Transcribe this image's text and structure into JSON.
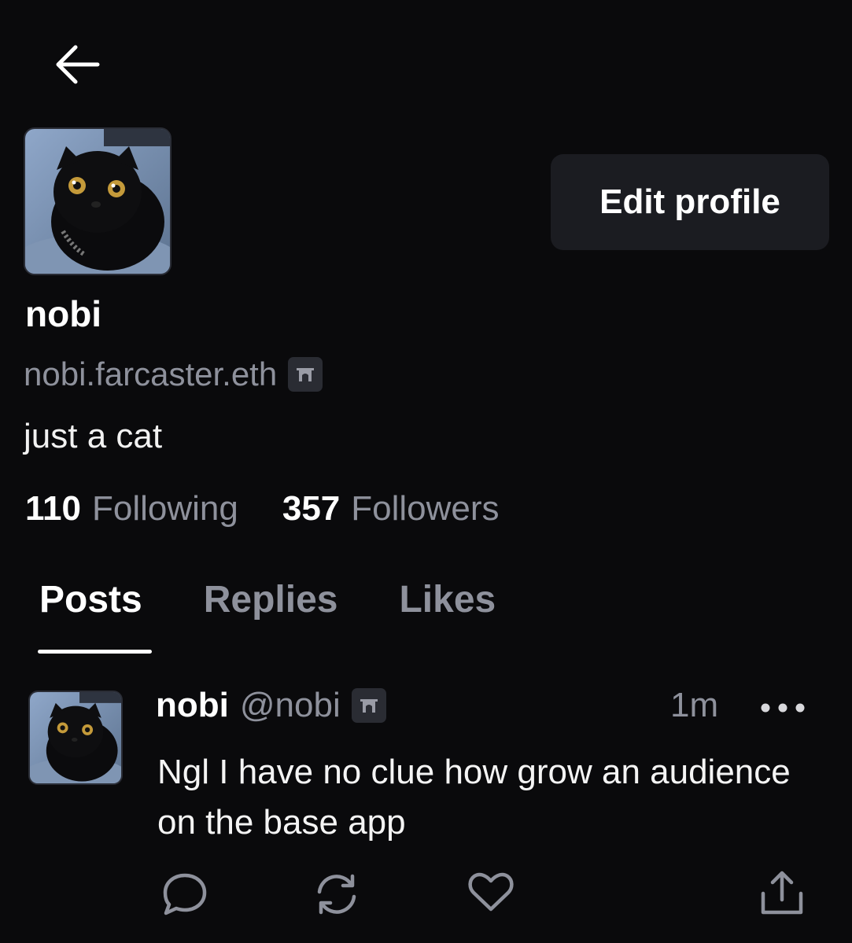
{
  "header": {
    "back_icon": "arrow-left-icon"
  },
  "profile": {
    "avatar_icon": "black-cat-avatar",
    "edit_label": "Edit profile",
    "display_name": "nobi",
    "fname": "nobi.farcaster.eth",
    "fname_badge_icon": "farcaster-arch-icon",
    "bio": "just a cat",
    "following_count": "110",
    "following_label": "Following",
    "followers_count": "357",
    "followers_label": "Followers"
  },
  "tabs": [
    {
      "label": "Posts",
      "active": true
    },
    {
      "label": "Replies",
      "active": false
    },
    {
      "label": "Likes",
      "active": false
    }
  ],
  "post": {
    "author_name": "nobi",
    "author_handle": "@nobi",
    "time": "1m",
    "text": "Ngl I have no clue how grow an audience on the base app",
    "actions": [
      "reply-icon",
      "recast-icon",
      "like-icon",
      "share-icon"
    ]
  },
  "colors": {
    "background": "#0a0a0c",
    "button_bg": "#1b1c21",
    "muted_text": "#8e919c",
    "text": "#ffffff"
  }
}
